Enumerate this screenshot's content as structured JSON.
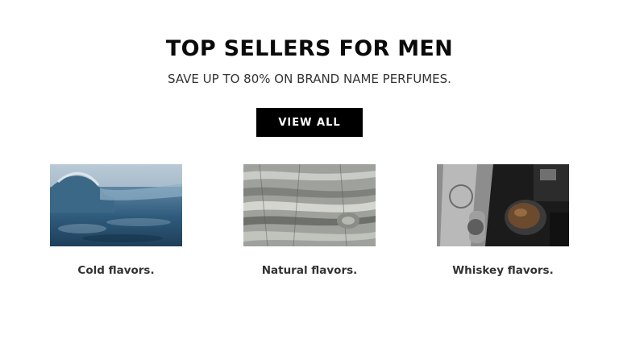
{
  "section": {
    "title": "TOP SELLERS FOR MEN",
    "subtitle": "SAVE UP TO 80% ON BRAND NAME PERFUMES.",
    "cta_label": "VIEW ALL"
  },
  "products": [
    {
      "caption": "Cold flavors.",
      "image": "ocean-wave-photo"
    },
    {
      "caption": "Natural flavors.",
      "image": "tree-bark-photo"
    },
    {
      "caption": "Whiskey flavors.",
      "image": "whiskey-flask-photo"
    }
  ],
  "colors": {
    "button_bg": "#000000",
    "button_text": "#ffffff",
    "heading": "#0a0a0a",
    "caption": "#333333"
  }
}
